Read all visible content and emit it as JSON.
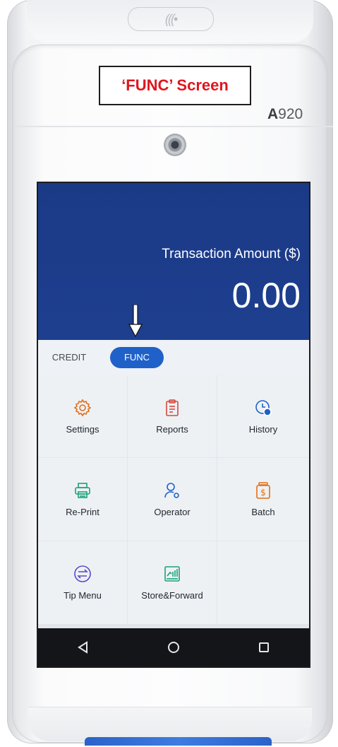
{
  "device": {
    "nfc_symbol": "(((•",
    "model_prefix": "A",
    "model_number": "920"
  },
  "annotation": {
    "label": "‘FUNC’ Screen",
    "label_color": "#e0161d"
  },
  "screen": {
    "amount_label": "Transaction Amount ($)",
    "amount_value": "0.00",
    "header_bg": "#1f3c8a",
    "tabs": [
      {
        "label": "CREDIT",
        "selected": false
      },
      {
        "label": "FUNC",
        "selected": true
      }
    ],
    "accent": "#1f61c9",
    "icon_color": "#e0701a",
    "functions": [
      {
        "label": "Settings",
        "icon": "gear-icon"
      },
      {
        "label": "Reports",
        "icon": "clipboard-icon"
      },
      {
        "label": "History",
        "icon": "clock-dollar-icon"
      },
      {
        "label": "Re-Print",
        "icon": "printer-icon"
      },
      {
        "label": "Operator",
        "icon": "user-gear-icon"
      },
      {
        "label": "Batch",
        "icon": "cash-jar-icon"
      },
      {
        "label": "Tip Menu",
        "icon": "swap-arrows-icon"
      },
      {
        "label": "Store&Forward",
        "icon": "chart-box-icon"
      }
    ],
    "nav": [
      {
        "icon": "back-triangle-icon"
      },
      {
        "icon": "home-circle-icon"
      },
      {
        "icon": "recents-square-icon"
      }
    ]
  }
}
